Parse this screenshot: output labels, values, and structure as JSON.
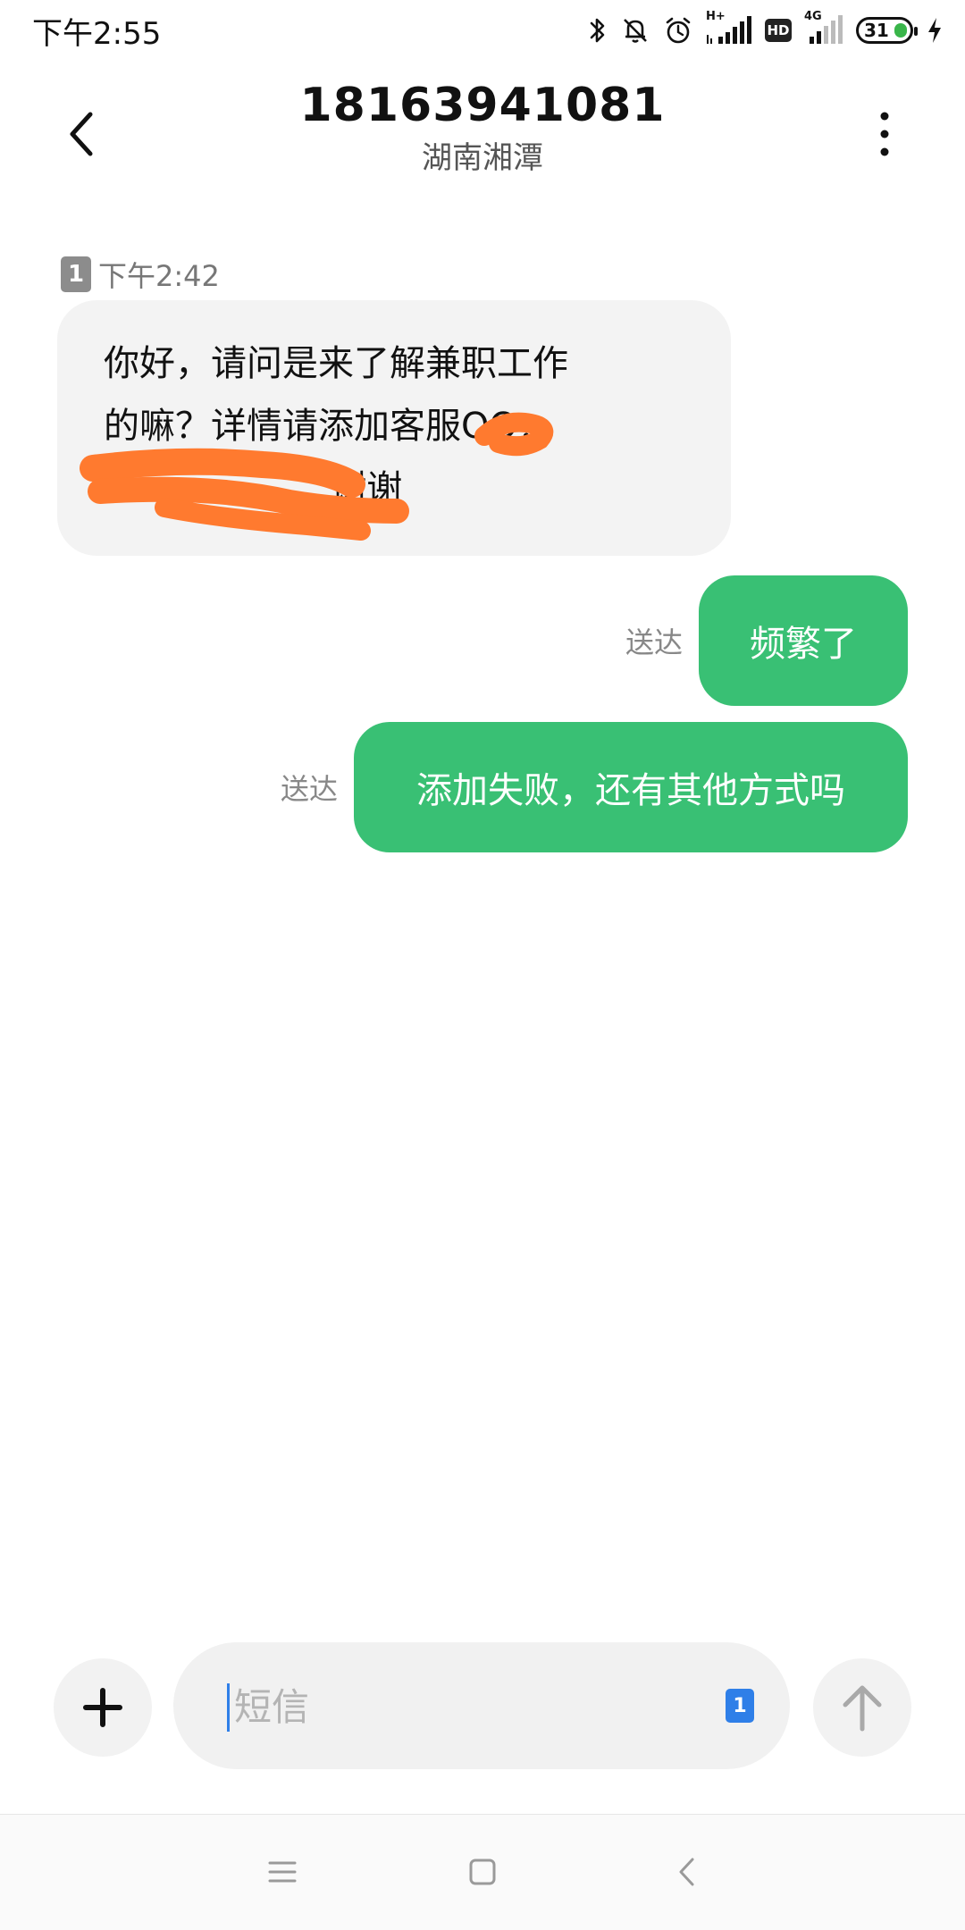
{
  "status_bar": {
    "time": "下午2:55",
    "network_type": "H+",
    "network_type_2": "4G",
    "hd_label": "HD",
    "battery_level": "31",
    "icons": [
      "bluetooth-icon",
      "notifications-off-icon",
      "alarm-icon",
      "signal-icon",
      "hd-icon",
      "signal-4g-icon",
      "battery-icon",
      "charging-icon"
    ]
  },
  "header": {
    "contact_number": "18163941081",
    "contact_location": "湖南湘潭",
    "back_icon": "chevron-left-icon",
    "more_icon": "more-vertical-icon"
  },
  "messages": [
    {
      "direction": "incoming",
      "sim_slot": "1",
      "time": "下午2:42",
      "text": "你好，请问是来了解兼职工作\n的嘛？详情请添加客服QQ：\n                    谢谢",
      "redacted": true
    },
    {
      "direction": "outgoing",
      "status": "送达",
      "text": "频繁了"
    },
    {
      "direction": "outgoing",
      "status": "送达",
      "text": "添加失败，还有其他方式吗"
    }
  ],
  "composer": {
    "placeholder": "短信",
    "value": "",
    "sim_slot": "1",
    "attach_icon": "plus-icon",
    "send_icon": "arrow-up-icon"
  },
  "nav_bar": {
    "icons": [
      "menu-icon",
      "home-square-icon",
      "back-chevron-icon"
    ]
  },
  "colors": {
    "outgoing_bubble": "#39c074",
    "incoming_bubble": "#f3f3f3",
    "redaction": "#ff7a2f",
    "accent_blue": "#2f7fe8"
  }
}
